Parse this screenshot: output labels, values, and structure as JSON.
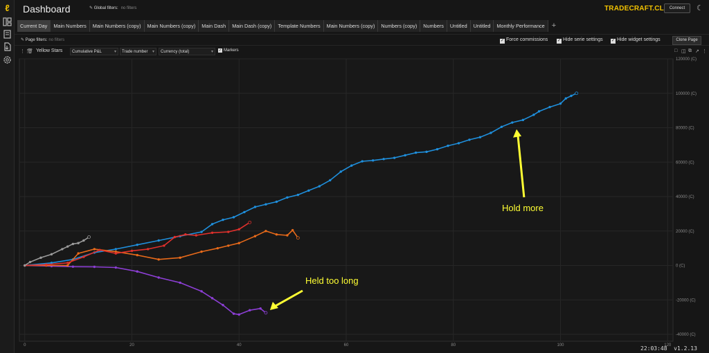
{
  "app": {
    "title": "Dashboard",
    "global_filters_label": "Global filters:",
    "global_filters_value": "no filters",
    "brand": "TRADECRAFT.CLUB",
    "connect_label": "Connect"
  },
  "rail_icons": [
    "logo-icon",
    "dashboard-icon",
    "journal-icon",
    "import-icon",
    "settings-icon"
  ],
  "tabs": [
    "Current Day",
    "Main Numbers",
    "Main Numbers (copy)",
    "Main Numbers (copy)",
    "Main Dash",
    "Main Dash (copy)",
    "Template Numbers",
    "Main Numbers (copy)",
    "Numbers  (copy)",
    "Numbers",
    "Untitled",
    "Untitled",
    "Monthly Performance"
  ],
  "active_tab": 0,
  "page": {
    "filters_label": "Page filters:",
    "filters_value": "no filters",
    "force_commissions": "Force commissions",
    "hide_serie_settings": "Hide serie settings",
    "hide_widget_settings": "Hide widget settings",
    "clone_label": "Clone Page"
  },
  "widget": {
    "name": "Yellow Stars",
    "metric": "Cumulative P&L",
    "x_mode": "Trade number",
    "currency": "Currency (total)",
    "markers_label": "Markers"
  },
  "status": {
    "clock": "22:03:48",
    "version": "v1.2.13"
  },
  "colors": {
    "blue": "#1f8fdc",
    "purple": "#8d3fd6",
    "orange": "#e86a1a",
    "red": "#e0302c",
    "gray": "#9a9a9a",
    "gold": "#f2c200",
    "annotation": "#ffff33"
  },
  "chart_data": {
    "type": "line",
    "xlabel": "",
    "ylabel": "",
    "x_ticks": [
      0,
      20,
      40,
      60,
      80,
      100,
      120
    ],
    "y_ticks": [
      120000,
      100000,
      80000,
      60000,
      40000,
      20000,
      0,
      -20000,
      -40000
    ],
    "y_tick_labels": [
      "120000 (C)",
      "100000 (C)",
      "80000 (C)",
      "60000 (C)",
      "40000 (C)",
      "20000 (C)",
      "0 (C)",
      "-20000 (C)",
      "-40000 (C)"
    ],
    "xlim": [
      -1,
      121
    ],
    "ylim": [
      -44000,
      120000
    ],
    "grid": true,
    "series": [
      {
        "color": "#1f8fdc",
        "x": [
          0,
          5,
          9,
          13,
          17,
          21,
          25,
          29,
          33,
          35,
          37,
          39,
          41,
          43,
          45,
          47,
          49,
          51,
          53,
          55,
          57,
          59,
          61,
          63,
          65,
          67,
          69,
          71,
          73,
          75,
          77,
          79,
          81,
          83,
          85,
          87,
          89,
          91,
          93,
          95,
          96,
          98,
          100,
          101,
          102,
          103
        ],
        "y": [
          0,
          1500,
          3500,
          7500,
          9500,
          12000,
          14500,
          17000,
          19500,
          24000,
          26500,
          28000,
          31000,
          34000,
          35500,
          37000,
          39500,
          41000,
          43500,
          46000,
          49500,
          54500,
          58000,
          60500,
          61000,
          61800,
          62500,
          64000,
          65500,
          66000,
          67500,
          69500,
          71000,
          73000,
          74500,
          77000,
          80500,
          83000,
          84500,
          87500,
          89500,
          92000,
          94000,
          97000,
          98500,
          100000
        ]
      },
      {
        "color": "#8d3fd6",
        "x": [
          0,
          5,
          9,
          13,
          17,
          21,
          25,
          29,
          33,
          35,
          37,
          39,
          40,
          42,
          44,
          45
        ],
        "y": [
          0,
          -400,
          -700,
          -800,
          -1200,
          -3500,
          -7000,
          -10000,
          -15000,
          -19000,
          -23000,
          -28000,
          -28500,
          -26000,
          -25000,
          -27500
        ]
      },
      {
        "color": "#e86a1a",
        "x": [
          0,
          4,
          8,
          10,
          13,
          17,
          21,
          25,
          29,
          33,
          36,
          38,
          40,
          43,
          45,
          47,
          49,
          50,
          51
        ],
        "y": [
          0,
          0,
          0,
          7000,
          9500,
          8000,
          6000,
          3500,
          4500,
          8000,
          10000,
          11500,
          13000,
          17000,
          20000,
          18000,
          17500,
          20500,
          16000
        ]
      },
      {
        "color": "#e0302c",
        "x": [
          0,
          4,
          8,
          11,
          14,
          17,
          20,
          23,
          26,
          28,
          30,
          32,
          35,
          38,
          40,
          42
        ],
        "y": [
          0,
          500,
          1500,
          5000,
          9000,
          7000,
          8500,
          9500,
          11500,
          16500,
          18000,
          17500,
          19000,
          19500,
          21000,
          25000
        ]
      },
      {
        "color": "#9a9a9a",
        "x": [
          0,
          1,
          3,
          5,
          7,
          8,
          9,
          10,
          11,
          12
        ],
        "y": [
          0,
          2000,
          4500,
          6500,
          9500,
          11000,
          12500,
          13000,
          14500,
          16500
        ]
      }
    ],
    "annotations": [
      {
        "text": "Hold more"
      },
      {
        "text": "Held too long"
      }
    ]
  }
}
